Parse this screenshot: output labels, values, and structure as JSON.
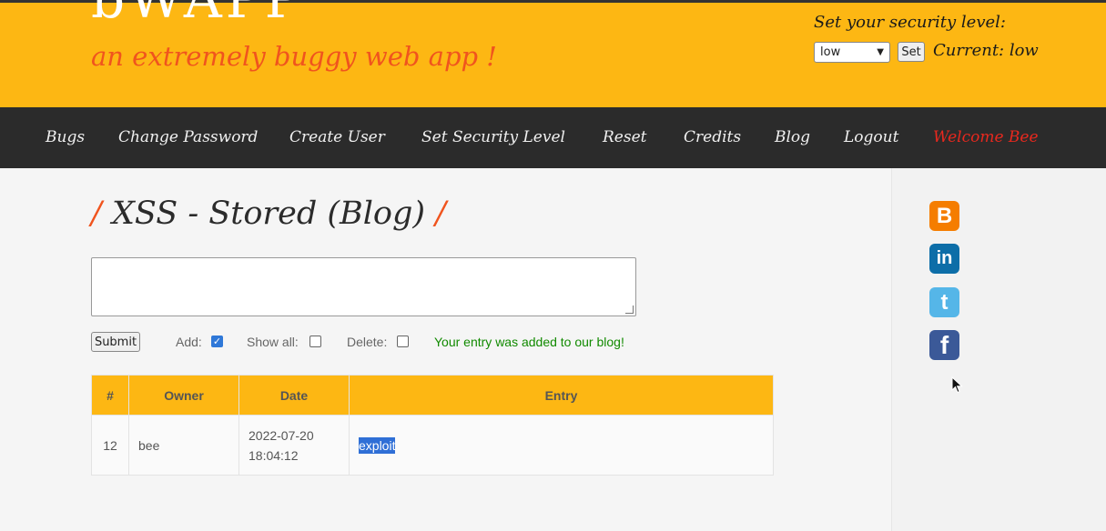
{
  "header": {
    "logo": "bWAPP",
    "tagline": "an extremely buggy web app !",
    "security_label": "Set your security level:",
    "security_select_value": "low",
    "set_button": "Set",
    "current_label": "Current: low"
  },
  "nav": [
    "Bugs",
    "Change Password",
    "Create User",
    "Set Security Level",
    "Reset",
    "Credits",
    "Blog",
    "Logout",
    "Welcome Bee"
  ],
  "page": {
    "title": "XSS - Stored (Blog)",
    "title_slash": "/"
  },
  "form": {
    "textarea_value": "",
    "submit": "Submit",
    "add_label": "Add:",
    "add_checked": true,
    "show_all_label": "Show all:",
    "show_all_checked": false,
    "delete_label": "Delete:",
    "delete_checked": false,
    "status": "Your entry was added to our blog!"
  },
  "table": {
    "headers": [
      "#",
      "Owner",
      "Date",
      "Entry"
    ],
    "rows": [
      {
        "num": "12",
        "owner": "bee",
        "date": "2022-07-20",
        "time": "18:04:12",
        "entry": "exploit"
      }
    ]
  },
  "social": [
    "blogger-icon",
    "linkedin-icon",
    "twitter-icon",
    "facebook-icon"
  ],
  "colors": {
    "header_bg": "#fdb713",
    "nav_bg": "#2b2b2b",
    "accent_orange": "#f0541e",
    "welcome_red": "#e8281e",
    "status_green": "#118a00"
  }
}
